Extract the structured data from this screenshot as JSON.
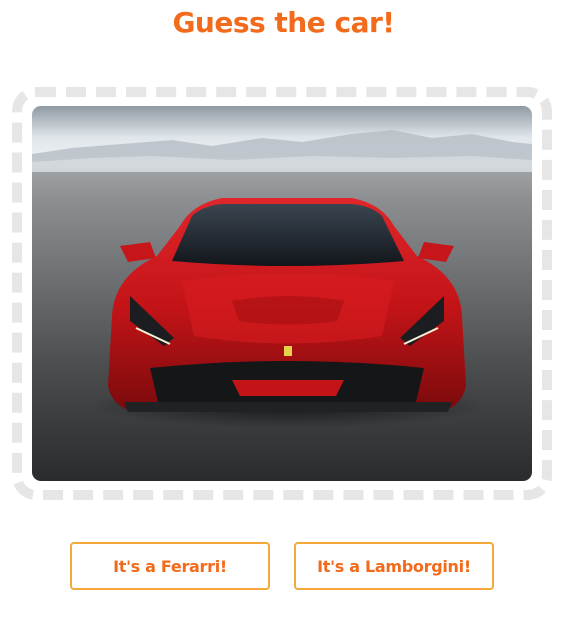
{
  "quiz": {
    "title": "Guess the car!",
    "image_icon": "red-sports-car-photo",
    "answers": [
      {
        "label": "It's a Ferarri!"
      },
      {
        "label": "It's a Lamborgini!"
      }
    ]
  },
  "colors": {
    "accent": "#f26a1b",
    "button_border": "#f4a93a",
    "frame_border": "#e6e6e6"
  }
}
